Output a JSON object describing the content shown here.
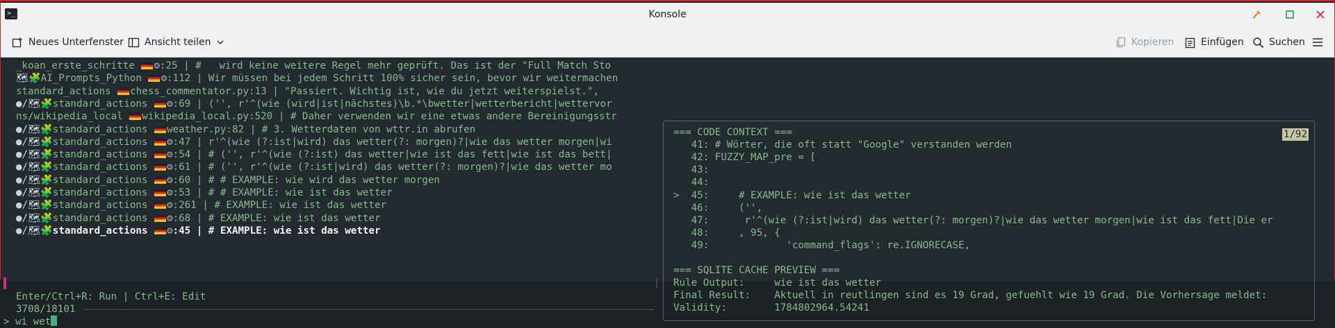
{
  "window": {
    "title": "Konsole"
  },
  "toolbar": {
    "new_tab": "Neues Unterfenster",
    "split_view": "Ansicht teilen",
    "copy": "Kopieren",
    "paste": "Einfügen",
    "find": "Suchen"
  },
  "results": [
    {
      "pre": "_koan_erste_schritte ",
      "post": ":25 | #   wird keine weitere Regel mehr geprüft. Das ist der \"Full Match Sto"
    },
    {
      "pre": "AI_Prompts_Python ",
      "post": ":112 | Wir müssen bei jedem Schritt 100% sicher sein, bevor wir weitermachen"
    },
    {
      "pre": "standard_actions ",
      "post": "chess_commentator.py:13 | \"Passiert. Wichtig ist, wie du jetzt weiterspielst.\","
    },
    {
      "pre": "standard_actions ",
      "post": ":69 | ('', r'^(wie (wird|ist|nächstes)\\b.*\\bwetter|wetterbericht|wettervor"
    },
    {
      "pre": "ns/wikipedia_local ",
      "post": "wikipedia_local.py:520 | # Daher verwenden wir eine etwas andere Bereinigungsstr"
    },
    {
      "pre": "standard_actions ",
      "post": "weather.py:82 | # 3. Wetterdaten von wttr.in abrufen"
    },
    {
      "pre": "standard_actions ",
      "post": ":47 | r'^(wie (?:ist|wird) das wetter(?: morgen)?|wie das wetter morgen|wi"
    },
    {
      "pre": "standard_actions ",
      "post": ":54 | # ('', r'^(wie (?:ist) das wetter|wie ist das fett|wie ist das bett|"
    },
    {
      "pre": "standard_actions ",
      "post": ":61 | # ('', r'^(wie (?:ist|wird) das wetter(?: morgen)?|wie das wetter mo"
    },
    {
      "pre": "standard_actions ",
      "post": ":60 | # # EXAMPLE: wie wird das wetter morgen"
    },
    {
      "pre": "standard_actions ",
      "post": ":53 | # # EXAMPLE: wie ist das wetter"
    },
    {
      "pre": "standard_actions ",
      "post": ":261 | # EXAMPLE: wie ist das wetter"
    },
    {
      "pre": "standard_actions ",
      "post": ":68 | # EXAMPLE: wie ist das wetter"
    },
    {
      "pre": "standard_actions ",
      "post": ":45 | # EXAMPLE: wie ist das wetter"
    }
  ],
  "status_line": "Enter/Ctrl+R: Run | Ctrl+E: Edit",
  "match_count": "3708/18101",
  "prompt": {
    "symbol": ">",
    "query": "wi wet"
  },
  "preview": {
    "position": "1/92",
    "lines": [
      "=== CODE CONTEXT ===",
      "   41: # Wörter, die oft statt \"Google\" verstanden werden",
      "   42: FUZZY_MAP_pre = [",
      "   43:",
      "   44:",
      ">  45:     # EXAMPLE: wie ist das wetter",
      "   46:     ('',",
      "   47:      r'^(wie (?:ist|wird) das wetter(?: morgen)?|wie das wetter morgen|wie ist das fett|Die er",
      "   48:     , 95, {",
      "   49:             'command_flags': re.IGNORECASE,",
      "",
      "=== SQLITE CACHE PREVIEW ===",
      "Rule Output:     wie ist das wetter",
      "Final Result:    Aktuell in reutlingen sind es 19 Grad, gefuehlt wie 19 Grad. Die Vorhersage meldet:",
      "Validity:        1784802964.54241"
    ]
  },
  "colors": {
    "terminal_bg": "#232b30",
    "text_green": "#86b98b",
    "selection_marker": "#d0317a",
    "cursor": "#3fb57e",
    "titlebar_accent": "#e0201c"
  }
}
